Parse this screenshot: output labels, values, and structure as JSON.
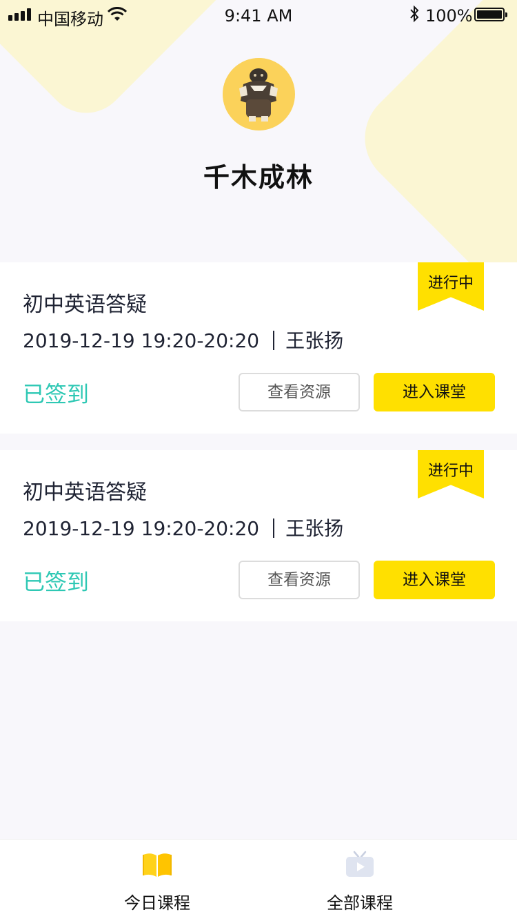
{
  "status_bar": {
    "carrier": "中国移动",
    "time": "9:41 AM",
    "battery": "100%"
  },
  "profile": {
    "name": "千木成林"
  },
  "courses": [
    {
      "title": "初中英语答疑",
      "datetime": "2019-12-19 19:20-20:20",
      "teacher": "王张扬",
      "checkin_status": "已签到",
      "badge": "进行中",
      "resource_button": "查看资源",
      "enter_button": "进入课堂"
    },
    {
      "title": "初中英语答疑",
      "datetime": "2019-12-19 19:20-20:20",
      "teacher": "王张扬",
      "checkin_status": "已签到",
      "badge": "进行中",
      "resource_button": "查看资源",
      "enter_button": "进入课堂"
    }
  ],
  "tabbar": {
    "tabs": [
      {
        "label": "今日课程",
        "icon": "book-icon",
        "active": true
      },
      {
        "label": "全部课程",
        "icon": "tv-play-icon",
        "active": false
      }
    ]
  },
  "colors": {
    "accent": "#ffe000",
    "checked_in": "#2ec8b4",
    "background": "#f8f7fb",
    "decoration": "#fbf6d3"
  }
}
